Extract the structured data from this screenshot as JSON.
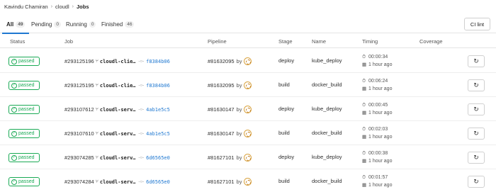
{
  "breadcrumb": [
    {
      "label": "Kavindu Chamiran"
    },
    {
      "label": "cloudl"
    },
    {
      "label": "Jobs"
    }
  ],
  "tabs": [
    {
      "label": "All",
      "count": "49",
      "active": true
    },
    {
      "label": "Pending",
      "count": "0"
    },
    {
      "label": "Running",
      "count": "0"
    },
    {
      "label": "Finished",
      "count": "46"
    }
  ],
  "ci_lint_label": "CI lint",
  "columns": {
    "status": "Status",
    "job": "Job",
    "pipeline": "Pipeline",
    "stage": "Stage",
    "name": "Name",
    "timing": "Timing",
    "coverage": "Coverage"
  },
  "colors": {
    "success": "#1aaa55",
    "link": "#1f78d1",
    "tab_underline": "#1f78d1"
  },
  "icons": {
    "branch": "branch-icon",
    "commit": "commit-icon",
    "timer": "timer-icon",
    "calendar": "calendar-icon",
    "retry": "retry-icon"
  },
  "jobs": [
    {
      "status": "passed",
      "id": "#293125196",
      "ref": "cloudl-clie…",
      "sha": "f8384b06",
      "pipeline": "#81632095",
      "by": "by",
      "stage": "deploy",
      "name": "kube_deploy",
      "duration": "00:00:34",
      "finished": "1 hour ago"
    },
    {
      "status": "passed",
      "id": "#293125195",
      "ref": "cloudl-clie…",
      "sha": "f8384b06",
      "pipeline": "#81632095",
      "by": "by",
      "stage": "build",
      "name": "docker_build",
      "duration": "00:06:24",
      "finished": "1 hour ago"
    },
    {
      "status": "passed",
      "id": "#293107612",
      "ref": "cloudl-serv…",
      "sha": "4ab1e5c5",
      "pipeline": "#81630147",
      "by": "by",
      "stage": "deploy",
      "name": "kube_deploy",
      "duration": "00:00:45",
      "finished": "1 hour ago"
    },
    {
      "status": "passed",
      "id": "#293107610",
      "ref": "cloudl-serv…",
      "sha": "4ab1e5c5",
      "pipeline": "#81630147",
      "by": "by",
      "stage": "build",
      "name": "docker_build",
      "duration": "00:02:03",
      "finished": "1 hour ago"
    },
    {
      "status": "passed",
      "id": "#293074285",
      "ref": "cloudl-serv…",
      "sha": "6d6565e0",
      "pipeline": "#81627101",
      "by": "by",
      "stage": "deploy",
      "name": "kube_deploy",
      "duration": "00:00:38",
      "finished": "1 hour ago"
    },
    {
      "status": "passed",
      "id": "#293074284",
      "ref": "cloudl-serv…",
      "sha": "6d6565e0",
      "pipeline": "#81627101",
      "by": "by",
      "stage": "build",
      "name": "docker_build",
      "duration": "00:01:57",
      "finished": "1 hour ago"
    }
  ]
}
